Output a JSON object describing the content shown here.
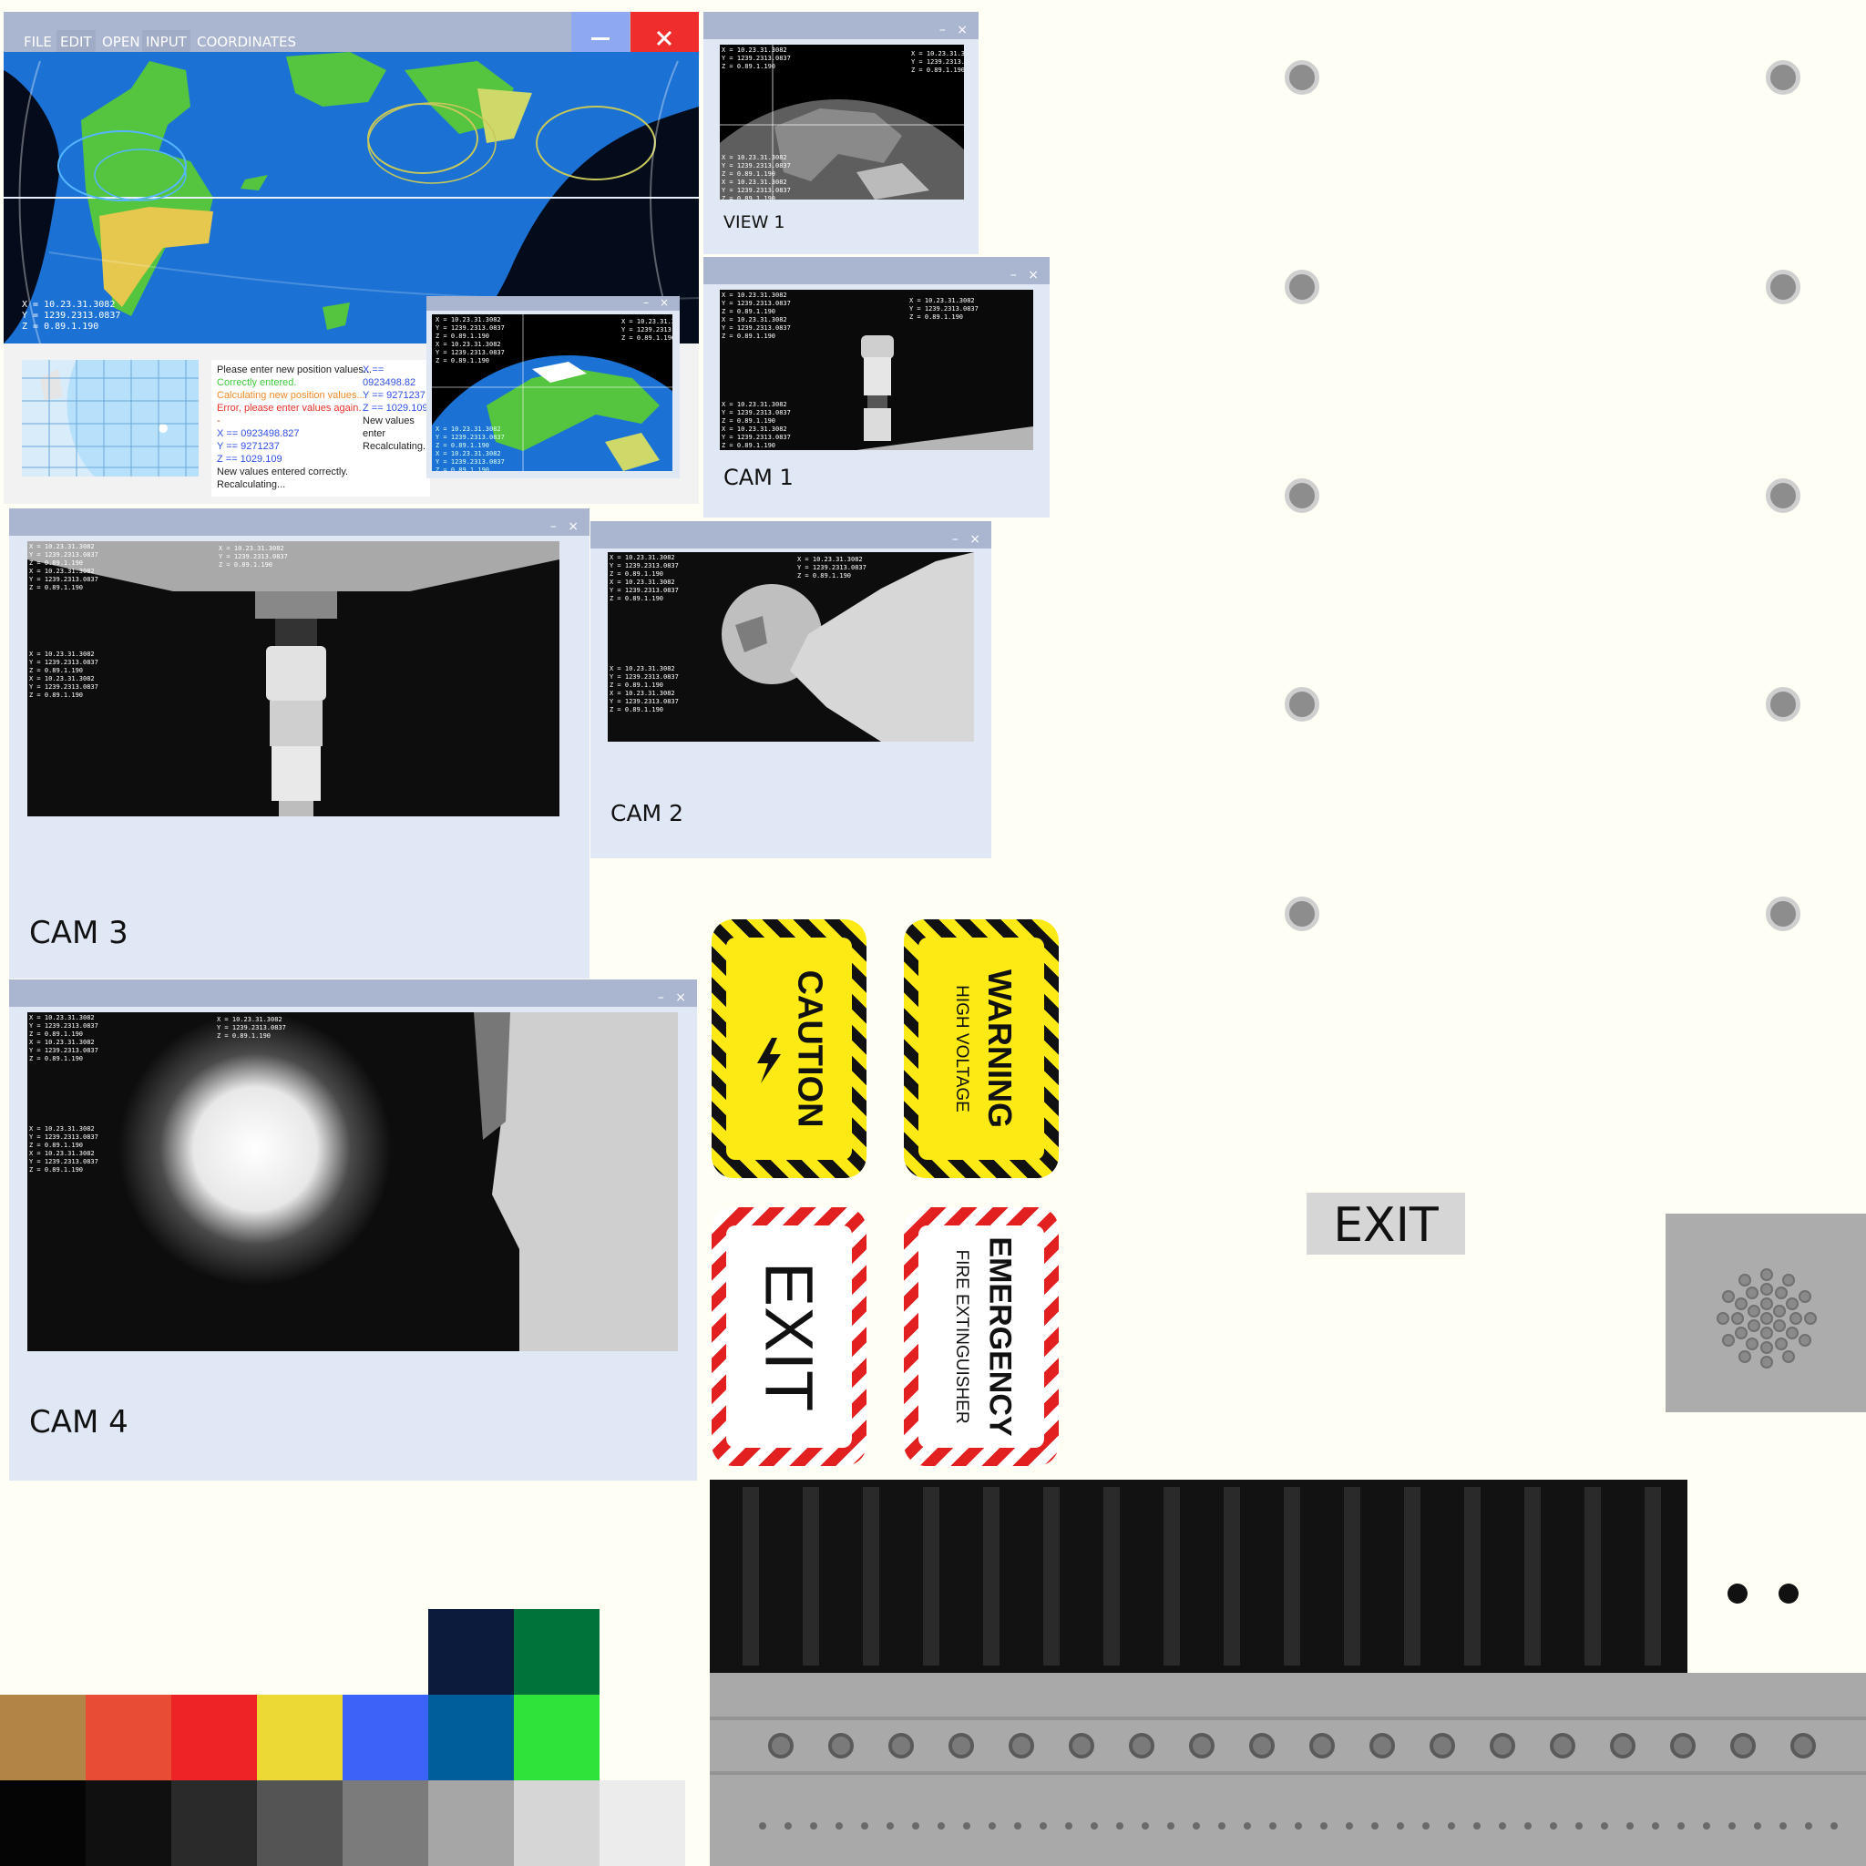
{
  "main_window": {
    "menu": [
      "FILE",
      "EDIT",
      "OPEN",
      "INPUT",
      "COORDINATES"
    ],
    "map_coords": "X = 10.23.31.3082\nY = 1239.2313.0837\nZ = 0.89.1.190",
    "console_lines": [
      {
        "text": "Please enter new position values...",
        "color": "#222222"
      },
      {
        "text": "Correctly entered.",
        "color": "#3ec93e"
      },
      {
        "text": "Calculating new position values...",
        "color": "#f08a2a"
      },
      {
        "text": "Error, please enter values again.",
        "color": "#e8332a"
      },
      {
        "text": "-",
        "color": "#e8332a"
      },
      {
        "text": "X == 0923498.827",
        "color": "#3150e8"
      },
      {
        "text": "Y == 9271237",
        "color": "#3150e8"
      },
      {
        "text": "Z == 1029.109",
        "color": "#3150e8"
      },
      {
        "text": "New values entered correctly.",
        "color": "#222222"
      },
      {
        "text": "Recalculating...",
        "color": "#222222"
      }
    ],
    "console_right": [
      {
        "text": "X == 0923498.82",
        "color": "#3150e8"
      },
      {
        "text": "Y == 9271237",
        "color": "#3150e8"
      },
      {
        "text": "Z == 1029.109",
        "color": "#3150e8"
      },
      {
        "text": "New values enter",
        "color": "#222222"
      },
      {
        "text": "Recalculating...",
        "color": "#222222"
      }
    ]
  },
  "hud_block": "X = 10.23.31.3082\nY = 1239.2313.0837\nZ = 0.89.1.190",
  "hud_block_long": "X = 10.23.31.3082\nY = 1239.2313.0837\nZ = 0.89.1.190\nX = 10.23.31.3082\nY = 1239.2313.0837\nZ = 0.89.1.190",
  "window_controls": "– ×",
  "camera_windows": {
    "view1": "VIEW 1",
    "cam1": "CAM 1",
    "cam2": "CAM 2",
    "cam3": "CAM 3",
    "cam4": "CAM 4"
  },
  "signs": {
    "caution": "CAUTION",
    "warning": "WARNING",
    "warning_sub": "HIGH VOLTAGE",
    "exit_vertical": "EXIT",
    "emergency": "EMERGENCY",
    "emergency_sub": "FIRE EXTINGUISHER",
    "exit_plate": "EXIT"
  },
  "palette": {
    "row_top": [
      "#0c1a3c",
      "#00733a"
    ],
    "row_mid": [
      "#b28446",
      "#e84c35",
      "#ee2326",
      "#ecd933",
      "#3c63f8",
      "#005f9a",
      "#2ee33a"
    ],
    "row_bottom": [
      "#050505",
      "#101010",
      "#2a2a2a",
      "#545454",
      "#7b7b7b",
      "#a6a6a6",
      "#d6d6d6",
      "#ececec"
    ]
  }
}
